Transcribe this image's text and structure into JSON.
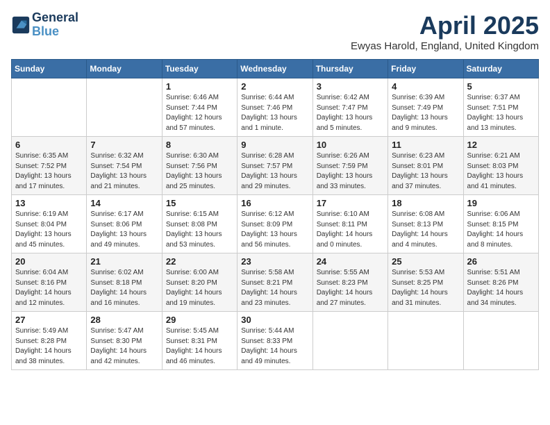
{
  "header": {
    "logo_line1": "General",
    "logo_line2": "Blue",
    "month": "April 2025",
    "location": "Ewyas Harold, England, United Kingdom"
  },
  "days_of_week": [
    "Sunday",
    "Monday",
    "Tuesday",
    "Wednesday",
    "Thursday",
    "Friday",
    "Saturday"
  ],
  "weeks": [
    [
      {
        "num": "",
        "info": ""
      },
      {
        "num": "",
        "info": ""
      },
      {
        "num": "1",
        "info": "Sunrise: 6:46 AM\nSunset: 7:44 PM\nDaylight: 12 hours and 57 minutes."
      },
      {
        "num": "2",
        "info": "Sunrise: 6:44 AM\nSunset: 7:46 PM\nDaylight: 13 hours and 1 minute."
      },
      {
        "num": "3",
        "info": "Sunrise: 6:42 AM\nSunset: 7:47 PM\nDaylight: 13 hours and 5 minutes."
      },
      {
        "num": "4",
        "info": "Sunrise: 6:39 AM\nSunset: 7:49 PM\nDaylight: 13 hours and 9 minutes."
      },
      {
        "num": "5",
        "info": "Sunrise: 6:37 AM\nSunset: 7:51 PM\nDaylight: 13 hours and 13 minutes."
      }
    ],
    [
      {
        "num": "6",
        "info": "Sunrise: 6:35 AM\nSunset: 7:52 PM\nDaylight: 13 hours and 17 minutes."
      },
      {
        "num": "7",
        "info": "Sunrise: 6:32 AM\nSunset: 7:54 PM\nDaylight: 13 hours and 21 minutes."
      },
      {
        "num": "8",
        "info": "Sunrise: 6:30 AM\nSunset: 7:56 PM\nDaylight: 13 hours and 25 minutes."
      },
      {
        "num": "9",
        "info": "Sunrise: 6:28 AM\nSunset: 7:57 PM\nDaylight: 13 hours and 29 minutes."
      },
      {
        "num": "10",
        "info": "Sunrise: 6:26 AM\nSunset: 7:59 PM\nDaylight: 13 hours and 33 minutes."
      },
      {
        "num": "11",
        "info": "Sunrise: 6:23 AM\nSunset: 8:01 PM\nDaylight: 13 hours and 37 minutes."
      },
      {
        "num": "12",
        "info": "Sunrise: 6:21 AM\nSunset: 8:03 PM\nDaylight: 13 hours and 41 minutes."
      }
    ],
    [
      {
        "num": "13",
        "info": "Sunrise: 6:19 AM\nSunset: 8:04 PM\nDaylight: 13 hours and 45 minutes."
      },
      {
        "num": "14",
        "info": "Sunrise: 6:17 AM\nSunset: 8:06 PM\nDaylight: 13 hours and 49 minutes."
      },
      {
        "num": "15",
        "info": "Sunrise: 6:15 AM\nSunset: 8:08 PM\nDaylight: 13 hours and 53 minutes."
      },
      {
        "num": "16",
        "info": "Sunrise: 6:12 AM\nSunset: 8:09 PM\nDaylight: 13 hours and 56 minutes."
      },
      {
        "num": "17",
        "info": "Sunrise: 6:10 AM\nSunset: 8:11 PM\nDaylight: 14 hours and 0 minutes."
      },
      {
        "num": "18",
        "info": "Sunrise: 6:08 AM\nSunset: 8:13 PM\nDaylight: 14 hours and 4 minutes."
      },
      {
        "num": "19",
        "info": "Sunrise: 6:06 AM\nSunset: 8:15 PM\nDaylight: 14 hours and 8 minutes."
      }
    ],
    [
      {
        "num": "20",
        "info": "Sunrise: 6:04 AM\nSunset: 8:16 PM\nDaylight: 14 hours and 12 minutes."
      },
      {
        "num": "21",
        "info": "Sunrise: 6:02 AM\nSunset: 8:18 PM\nDaylight: 14 hours and 16 minutes."
      },
      {
        "num": "22",
        "info": "Sunrise: 6:00 AM\nSunset: 8:20 PM\nDaylight: 14 hours and 19 minutes."
      },
      {
        "num": "23",
        "info": "Sunrise: 5:58 AM\nSunset: 8:21 PM\nDaylight: 14 hours and 23 minutes."
      },
      {
        "num": "24",
        "info": "Sunrise: 5:55 AM\nSunset: 8:23 PM\nDaylight: 14 hours and 27 minutes."
      },
      {
        "num": "25",
        "info": "Sunrise: 5:53 AM\nSunset: 8:25 PM\nDaylight: 14 hours and 31 minutes."
      },
      {
        "num": "26",
        "info": "Sunrise: 5:51 AM\nSunset: 8:26 PM\nDaylight: 14 hours and 34 minutes."
      }
    ],
    [
      {
        "num": "27",
        "info": "Sunrise: 5:49 AM\nSunset: 8:28 PM\nDaylight: 14 hours and 38 minutes."
      },
      {
        "num": "28",
        "info": "Sunrise: 5:47 AM\nSunset: 8:30 PM\nDaylight: 14 hours and 42 minutes."
      },
      {
        "num": "29",
        "info": "Sunrise: 5:45 AM\nSunset: 8:31 PM\nDaylight: 14 hours and 46 minutes."
      },
      {
        "num": "30",
        "info": "Sunrise: 5:44 AM\nSunset: 8:33 PM\nDaylight: 14 hours and 49 minutes."
      },
      {
        "num": "",
        "info": ""
      },
      {
        "num": "",
        "info": ""
      },
      {
        "num": "",
        "info": ""
      }
    ]
  ]
}
